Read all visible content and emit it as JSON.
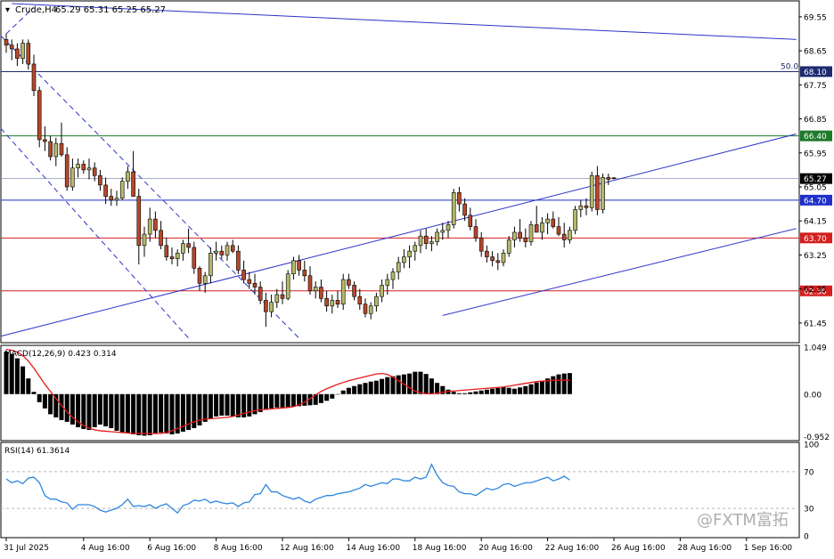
{
  "header": {
    "symbol_label": "Crude,H4",
    "ohlc_label": "65.29 65.31 65.25 65.27"
  },
  "colors": {
    "up_body": "#b5b86a",
    "down_body": "#b5482b",
    "wick": "#000000",
    "channel": "#2b33c8",
    "level_navy": "#1d2b6e",
    "level_green": "#1f7a2a",
    "level_blue": "#1f2fc8",
    "level_red": "#d31f1f",
    "macd_hist": "#000000",
    "macd_signal": "#e8191a",
    "rsi_line": "#2e86de"
  },
  "price_axis": {
    "range": [
      61.0,
      69.9
    ],
    "ticks": [
      "69.55",
      "68.65",
      "67.75",
      "66.85",
      "65.95",
      "65.05",
      "64.15",
      "63.25",
      "62.35",
      "61.45"
    ]
  },
  "price_levels": [
    {
      "value": 68.1,
      "label": "68.10",
      "color": "#1d2b6e",
      "fib_label": "50.0"
    },
    {
      "value": 66.4,
      "label": "66.40",
      "color": "#1f7a2a"
    },
    {
      "value": 65.27,
      "label": "65.27",
      "color": "#8a94b8",
      "current": true
    },
    {
      "value": 64.7,
      "label": "64.70",
      "color": "#1f2fc8"
    },
    {
      "value": 63.7,
      "label": "63.70",
      "color": "#d31f1f"
    },
    {
      "value": 62.3,
      "label": "62.30",
      "color": "#d31f1f"
    }
  ],
  "macd": {
    "label": "MACD(12,26,9) 0.423 0.314",
    "range": [
      -1.0,
      1.05
    ],
    "ticks": [
      "1.049",
      "0.00",
      "-0.952"
    ],
    "histogram": [
      0.95,
      0.9,
      0.8,
      0.62,
      0.35,
      0.05,
      -0.18,
      -0.32,
      -0.45,
      -0.52,
      -0.58,
      -0.62,
      -0.68,
      -0.74,
      -0.78,
      -0.8,
      -0.74,
      -0.68,
      -0.72,
      -0.76,
      -0.82,
      -0.86,
      -0.88,
      -0.9,
      -0.92,
      -0.93,
      -0.92,
      -0.88,
      -0.86,
      -0.88,
      -0.9,
      -0.88,
      -0.84,
      -0.8,
      -0.76,
      -0.7,
      -0.62,
      -0.55,
      -0.5,
      -0.48,
      -0.48,
      -0.5,
      -0.52,
      -0.52,
      -0.5,
      -0.45,
      -0.4,
      -0.35,
      -0.32,
      -0.3,
      -0.3,
      -0.29,
      -0.28,
      -0.27,
      -0.26,
      -0.25,
      -0.24,
      -0.2,
      -0.15,
      -0.1,
      0.0,
      0.08,
      0.14,
      0.18,
      0.22,
      0.25,
      0.28,
      0.3,
      0.34,
      0.38,
      0.4,
      0.42,
      0.44,
      0.46,
      0.5,
      0.5,
      0.45,
      0.35,
      0.25,
      0.18,
      0.1,
      0.05,
      0.02,
      0.02,
      0.04,
      0.06,
      0.08,
      0.1,
      0.12,
      0.14,
      0.16,
      0.14,
      0.12,
      0.15,
      0.18,
      0.22,
      0.26,
      0.3,
      0.35,
      0.4,
      0.44,
      0.46,
      0.47
    ],
    "signal": [
      1.0,
      0.98,
      0.94,
      0.86,
      0.74,
      0.58,
      0.4,
      0.22,
      0.06,
      -0.1,
      -0.25,
      -0.4,
      -0.52,
      -0.62,
      -0.7,
      -0.76,
      -0.8,
      -0.82,
      -0.83,
      -0.84,
      -0.85,
      -0.86,
      -0.87,
      -0.88,
      -0.88,
      -0.88,
      -0.88,
      -0.88,
      -0.88,
      -0.86,
      -0.82,
      -0.77,
      -0.72,
      -0.67,
      -0.62,
      -0.58,
      -0.56,
      -0.55,
      -0.54,
      -0.53,
      -0.52,
      -0.5,
      -0.47,
      -0.43,
      -0.4,
      -0.37,
      -0.35,
      -0.34,
      -0.33,
      -0.32,
      -0.31,
      -0.3,
      -0.28,
      -0.24,
      -0.18,
      -0.1,
      -0.02,
      0.06,
      0.12,
      0.17,
      0.22,
      0.26,
      0.3,
      0.33,
      0.36,
      0.39,
      0.42,
      0.45,
      0.46,
      0.44,
      0.38,
      0.3,
      0.22,
      0.14,
      0.07,
      0.03,
      0.01,
      0.01,
      0.02,
      0.04,
      0.06,
      0.07,
      0.08,
      0.09,
      0.1,
      0.11,
      0.12,
      0.13,
      0.14,
      0.15,
      0.16,
      0.18,
      0.2,
      0.22,
      0.24,
      0.26,
      0.28,
      0.29,
      0.3,
      0.31,
      0.31,
      0.31,
      0.31
    ]
  },
  "rsi": {
    "label": "RSI(14) 61.3614",
    "range": [
      0,
      100
    ],
    "ticks": [
      "100",
      "70",
      "30",
      "0"
    ],
    "levels": [
      70,
      30
    ],
    "values": [
      62,
      58,
      60,
      57,
      63,
      64,
      58,
      44,
      40,
      40,
      37,
      36,
      29,
      34,
      34,
      34,
      32,
      28,
      26,
      28,
      30,
      34,
      40,
      32,
      33,
      32,
      34,
      30,
      33,
      35,
      30,
      25,
      33,
      35,
      39,
      38,
      40,
      36,
      38,
      36,
      35,
      36,
      32,
      36,
      37,
      45,
      46,
      56,
      48,
      48,
      44,
      42,
      40,
      42,
      38,
      36,
      40,
      42,
      44,
      44,
      46,
      47,
      48,
      50,
      52,
      56,
      54,
      56,
      58,
      57,
      62,
      62,
      60,
      60,
      64,
      62,
      64,
      78,
      66,
      58,
      55,
      54,
      48,
      46,
      46,
      44,
      48,
      52,
      50,
      52,
      56,
      57,
      54,
      56,
      58,
      58,
      60,
      62,
      64,
      60,
      62,
      65,
      61
    ]
  },
  "time_axis": {
    "labels": [
      {
        "text": "31 Jul 2025",
        "bar": 0
      },
      {
        "text": "4 Aug 16:00",
        "bar": 14
      },
      {
        "text": "6 Aug 16:00",
        "bar": 26
      },
      {
        "text": "8 Aug 16:00",
        "bar": 38
      },
      {
        "text": "12 Aug 16:00",
        "bar": 50
      },
      {
        "text": "14 Aug 16:00",
        "bar": 62
      },
      {
        "text": "18 Aug 16:00",
        "bar": 74
      },
      {
        "text": "20 Aug 16:00",
        "bar": 86
      },
      {
        "text": "22 Aug 16:00",
        "bar": 98
      },
      {
        "text": "26 Aug 16:00",
        "bar": 110
      },
      {
        "text": "28 Aug 16:00",
        "bar": 122
      },
      {
        "text": "1 Sep 16:00",
        "bar": 134
      }
    ]
  },
  "watermark": "@FXTM富拓",
  "chart_data": {
    "type": "candlestick",
    "title": "Crude,H4",
    "xlabel": "",
    "ylabel": "",
    "ylim": [
      61.0,
      69.9
    ],
    "grid": false,
    "series": [
      {
        "ohlc": [
          [
            68.95,
            69.1,
            68.6,
            68.8
          ],
          [
            68.8,
            68.95,
            68.4,
            68.7
          ],
          [
            68.7,
            68.85,
            68.25,
            68.45
          ],
          [
            68.45,
            68.95,
            68.3,
            68.85
          ],
          [
            68.85,
            68.95,
            68.15,
            68.3
          ],
          [
            68.3,
            68.55,
            67.45,
            67.6
          ],
          [
            67.6,
            67.7,
            66.1,
            66.3
          ],
          [
            66.3,
            66.65,
            66.0,
            66.25
          ],
          [
            66.25,
            66.4,
            65.75,
            65.85
          ],
          [
            65.85,
            66.35,
            65.6,
            66.2
          ],
          [
            66.2,
            66.75,
            65.85,
            65.9
          ],
          [
            65.9,
            66.1,
            64.95,
            65.05
          ],
          [
            65.05,
            65.8,
            64.95,
            65.55
          ],
          [
            65.55,
            65.8,
            65.3,
            65.65
          ],
          [
            65.65,
            65.75,
            65.4,
            65.5
          ],
          [
            65.5,
            65.8,
            65.25,
            65.55
          ],
          [
            65.55,
            65.7,
            65.2,
            65.35
          ],
          [
            65.35,
            65.5,
            64.95,
            65.1
          ],
          [
            65.1,
            65.3,
            64.6,
            64.8
          ],
          [
            64.8,
            65.0,
            64.55,
            64.7
          ],
          [
            64.7,
            64.95,
            64.55,
            64.75
          ],
          [
            64.75,
            65.3,
            64.7,
            65.2
          ],
          [
            65.2,
            65.6,
            65.0,
            65.45
          ],
          [
            65.45,
            66.0,
            65.2,
            64.8
          ],
          [
            64.8,
            65.0,
            63.0,
            63.5
          ],
          [
            63.5,
            64.0,
            63.2,
            63.8
          ],
          [
            63.8,
            64.5,
            63.6,
            64.2
          ],
          [
            64.2,
            64.4,
            63.7,
            63.9
          ],
          [
            63.9,
            64.15,
            63.4,
            63.5
          ],
          [
            63.5,
            63.7,
            63.1,
            63.2
          ],
          [
            63.2,
            63.45,
            63.0,
            63.15
          ],
          [
            63.15,
            63.4,
            62.95,
            63.3
          ],
          [
            63.3,
            63.65,
            63.1,
            63.55
          ],
          [
            63.55,
            63.95,
            63.3,
            63.45
          ],
          [
            63.45,
            63.6,
            62.75,
            62.9
          ],
          [
            62.9,
            62.95,
            62.3,
            62.5
          ],
          [
            62.5,
            62.8,
            62.25,
            62.7
          ],
          [
            62.7,
            63.45,
            62.5,
            63.3
          ],
          [
            63.3,
            63.6,
            63.1,
            63.35
          ],
          [
            63.35,
            63.5,
            63.15,
            63.25
          ],
          [
            63.25,
            63.6,
            63.1,
            63.5
          ],
          [
            63.5,
            63.65,
            63.3,
            63.35
          ],
          [
            63.35,
            63.5,
            62.75,
            62.85
          ],
          [
            62.85,
            63.1,
            62.5,
            62.6
          ],
          [
            62.6,
            62.8,
            62.35,
            62.5
          ],
          [
            62.5,
            62.75,
            62.2,
            62.4
          ],
          [
            62.4,
            62.55,
            61.95,
            62.05
          ],
          [
            62.05,
            62.25,
            61.35,
            61.75
          ],
          [
            61.75,
            62.2,
            61.6,
            62.0
          ],
          [
            62.0,
            62.35,
            61.85,
            62.2
          ],
          [
            62.2,
            62.55,
            61.95,
            62.1
          ],
          [
            62.1,
            62.85,
            62.05,
            62.75
          ],
          [
            62.75,
            63.2,
            62.6,
            63.1
          ],
          [
            63.1,
            63.25,
            62.7,
            62.85
          ],
          [
            62.85,
            63.1,
            62.55,
            62.7
          ],
          [
            62.7,
            62.95,
            62.2,
            62.3
          ],
          [
            62.3,
            62.55,
            62.1,
            62.4
          ],
          [
            62.4,
            62.6,
            62.0,
            62.1
          ],
          [
            62.1,
            62.3,
            61.75,
            61.9
          ],
          [
            61.9,
            62.2,
            61.7,
            62.05
          ],
          [
            62.05,
            62.3,
            61.85,
            61.95
          ],
          [
            61.95,
            62.75,
            61.8,
            62.6
          ],
          [
            62.6,
            62.75,
            62.35,
            62.45
          ],
          [
            62.45,
            62.55,
            62.05,
            62.15
          ],
          [
            62.15,
            62.35,
            61.8,
            61.95
          ],
          [
            61.95,
            62.1,
            61.6,
            61.7
          ],
          [
            61.7,
            62.0,
            61.55,
            61.9
          ],
          [
            61.9,
            62.25,
            61.75,
            62.15
          ],
          [
            62.15,
            62.6,
            62.0,
            62.45
          ],
          [
            62.45,
            62.75,
            62.2,
            62.6
          ],
          [
            62.6,
            62.9,
            62.35,
            62.8
          ],
          [
            62.8,
            63.2,
            62.6,
            63.05
          ],
          [
            63.05,
            63.4,
            62.9,
            63.2
          ],
          [
            63.2,
            63.5,
            62.9,
            63.35
          ],
          [
            63.35,
            63.6,
            63.1,
            63.5
          ],
          [
            63.5,
            63.9,
            63.3,
            63.75
          ],
          [
            63.75,
            63.95,
            63.4,
            63.55
          ],
          [
            63.55,
            63.75,
            63.35,
            63.6
          ],
          [
            63.6,
            63.95,
            63.5,
            63.85
          ],
          [
            63.85,
            64.1,
            63.65,
            63.9
          ],
          [
            63.9,
            64.15,
            63.7,
            64.05
          ],
          [
            64.05,
            65.0,
            63.95,
            64.9
          ],
          [
            64.9,
            65.05,
            64.4,
            64.6
          ],
          [
            64.6,
            64.75,
            64.15,
            64.3
          ],
          [
            64.3,
            64.5,
            63.9,
            64.0
          ],
          [
            64.0,
            64.2,
            63.6,
            63.7
          ],
          [
            63.7,
            63.85,
            63.2,
            63.35
          ],
          [
            63.35,
            63.5,
            63.05,
            63.2
          ],
          [
            63.2,
            63.35,
            62.95,
            63.1
          ],
          [
            63.1,
            63.3,
            62.85,
            63.05
          ],
          [
            63.05,
            63.4,
            62.95,
            63.3
          ],
          [
            63.3,
            63.75,
            63.2,
            63.65
          ],
          [
            63.65,
            64.0,
            63.45,
            63.85
          ],
          [
            63.85,
            64.2,
            63.6,
            63.7
          ],
          [
            63.7,
            63.95,
            63.45,
            63.6
          ],
          [
            63.6,
            64.15,
            63.5,
            64.05
          ],
          [
            64.05,
            64.55,
            63.85,
            63.85
          ],
          [
            63.85,
            64.25,
            63.65,
            64.1
          ],
          [
            64.1,
            64.35,
            63.8,
            64.2
          ],
          [
            64.2,
            64.4,
            63.95,
            64.0
          ],
          [
            64.0,
            64.25,
            63.75,
            63.8
          ],
          [
            63.8,
            64.1,
            63.45,
            63.65
          ],
          [
            63.65,
            64.0,
            63.55,
            63.9
          ],
          [
            63.9,
            64.55,
            63.8,
            64.45
          ],
          [
            64.45,
            64.7,
            64.25,
            64.55
          ],
          [
            64.55,
            64.75,
            64.3,
            64.5
          ],
          [
            64.5,
            65.45,
            64.4,
            65.35
          ],
          [
            65.35,
            65.6,
            64.3,
            64.45
          ],
          [
            64.45,
            65.4,
            64.35,
            65.3
          ],
          [
            65.3,
            65.4,
            65.1,
            65.25
          ],
          [
            65.29,
            65.31,
            65.25,
            65.27
          ]
        ]
      }
    ],
    "annotations": [
      "50.0"
    ]
  }
}
